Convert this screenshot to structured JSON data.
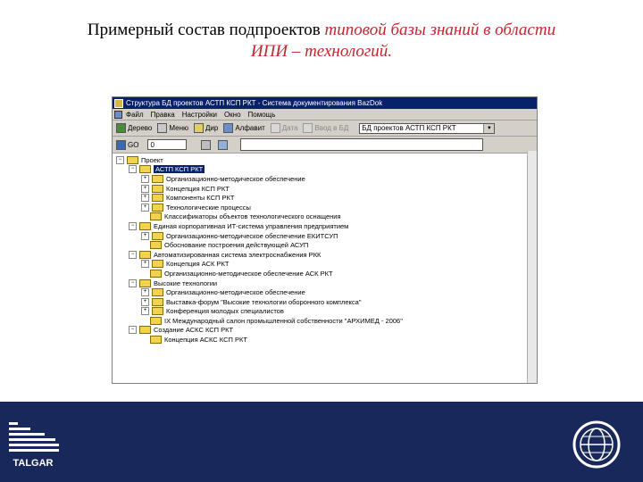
{
  "slide": {
    "title_plain": "Примерный состав подпроектов ",
    "title_emph": "типовой базы знаний в области ИПИ – технологий."
  },
  "window": {
    "title": "Структура БД проектов АСТП КСП РКТ - Система документирования BazDok",
    "menu": [
      "Файл",
      "Правка",
      "Настройки",
      "Окно",
      "Помощь"
    ],
    "toolbar1": {
      "buttons": [
        {
          "label": "Дерево",
          "enabled": true
        },
        {
          "label": "Меню",
          "enabled": true
        },
        {
          "label": "Дир",
          "enabled": true
        },
        {
          "label": "Алфавит",
          "enabled": true
        },
        {
          "label": "Дата",
          "enabled": false
        },
        {
          "label": "Ввод в БД",
          "enabled": false
        }
      ],
      "db_selector": "БД проектов АСТП КСП РКТ"
    },
    "toolbar2": {
      "go_label": "GO",
      "number_value": "0"
    },
    "tree": [
      {
        "level": 0,
        "label": "Проект",
        "exp": "-"
      },
      {
        "level": 1,
        "label": "АСТП КСП РКТ",
        "exp": "-",
        "selected": true
      },
      {
        "level": 2,
        "label": "Организационно-методическое обеспечение",
        "exp": "+"
      },
      {
        "level": 2,
        "label": "Концепция КСП РКТ",
        "exp": "+"
      },
      {
        "level": 2,
        "label": "Компоненты КСП РКТ",
        "exp": "+"
      },
      {
        "level": 2,
        "label": "Технологические процессы",
        "exp": "+"
      },
      {
        "level": 2,
        "label": "Классификаторы объектов технологического оснащения",
        "exp": ""
      },
      {
        "level": 1,
        "label": "Единая корпоративная ИТ-система управления предприятием",
        "exp": "-"
      },
      {
        "level": 2,
        "label": "Организационно-методическое обеспечение ЕКИТСУП",
        "exp": "+"
      },
      {
        "level": 2,
        "label": "Обоснование построения действующей АСУП",
        "exp": ""
      },
      {
        "level": 1,
        "label": "Автоматизированная система электроснабжения РКК",
        "exp": "-"
      },
      {
        "level": 2,
        "label": "Концепция АСК РКТ",
        "exp": "+"
      },
      {
        "level": 2,
        "label": "Организационно-методическое обеспечение АСК РКТ",
        "exp": ""
      },
      {
        "level": 1,
        "label": "Высокие технологии",
        "exp": "-"
      },
      {
        "level": 2,
        "label": "Организационно-методическое обеспечение",
        "exp": "+"
      },
      {
        "level": 2,
        "label": "Выставка-форум \"Высокие технологии оборонного комплекса\"",
        "exp": "+"
      },
      {
        "level": 2,
        "label": "Конференция молодых специалистов",
        "exp": "+"
      },
      {
        "level": 2,
        "label": "IX Международный салон промышленной собственности \"АРХИМЕД - 2006\"",
        "exp": ""
      },
      {
        "level": 1,
        "label": "Создание АСКС КСП РКТ",
        "exp": "-"
      },
      {
        "level": 2,
        "label": "Концепция АСКС КСП РКТ",
        "exp": ""
      }
    ]
  },
  "footer": {
    "logo_text": "TALGAR",
    "brand_color": "#19285a"
  }
}
